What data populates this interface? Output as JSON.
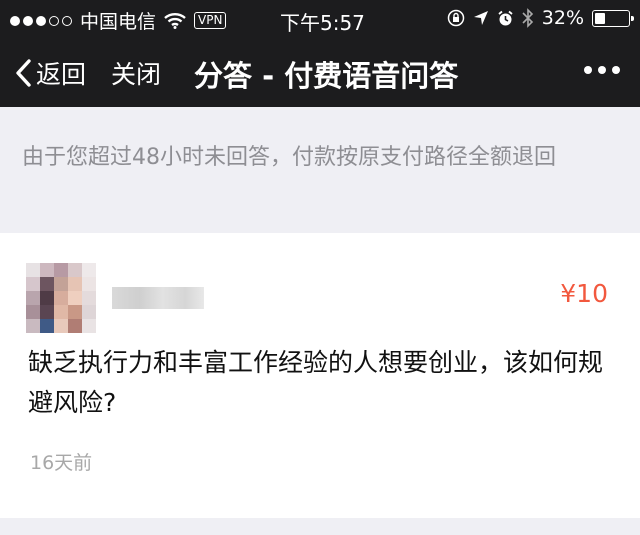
{
  "statusbar": {
    "carrier": "中国电信",
    "vpn": "VPN",
    "time": "下午5:57",
    "battery": "32%",
    "battery_level": 0.32
  },
  "navbar": {
    "back_label": "返回",
    "close_label": "关闭",
    "title": "分答 - 付费语音问答"
  },
  "notice": {
    "text": "由于您超过48小时未回答，付款按原支付路径全额退回"
  },
  "question_card": {
    "price": "¥10",
    "question": "缺乏执行力和丰富工作经验的人想要创业，该如何规避风险?",
    "time_ago": "16天前"
  },
  "colors": {
    "bar_bg": "#1c1c1e",
    "page_bg": "#efeff4",
    "price": "#f2583e",
    "muted_text": "#8e8e93"
  }
}
